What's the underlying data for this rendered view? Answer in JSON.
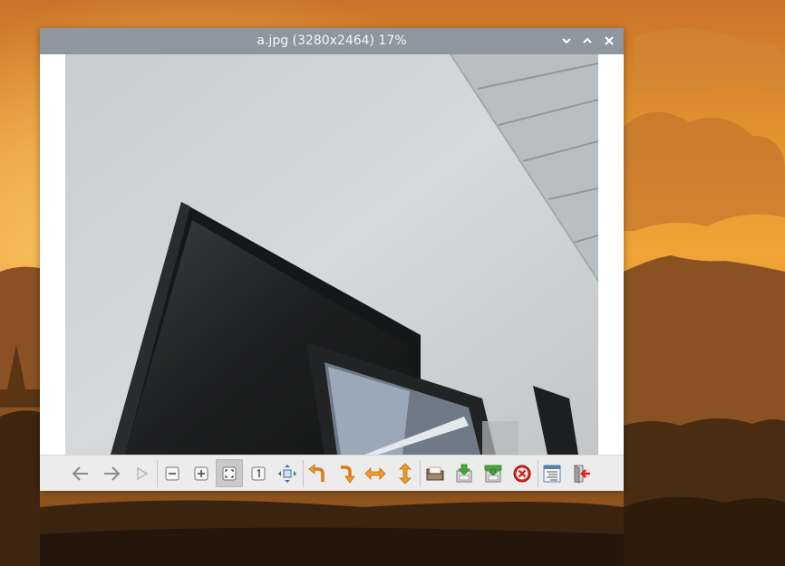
{
  "window": {
    "title": "a.jpg (3280x2464) 17%",
    "controls": [
      "minimize",
      "maximize",
      "close"
    ]
  },
  "image": {
    "description_icon": "photo-image",
    "subject_icons": [
      "monitor",
      "laptop-screen",
      "ceiling"
    ]
  },
  "toolbar": {
    "items": [
      {
        "name": "previous",
        "icon": "arrow-left-icon",
        "enabled": true
      },
      {
        "name": "next",
        "icon": "arrow-right-icon",
        "enabled": true
      },
      {
        "name": "slideshow",
        "icon": "play-icon",
        "enabled": false
      },
      {
        "name": "zoom-out",
        "icon": "zoom-out-icon",
        "enabled": true
      },
      {
        "name": "zoom-in",
        "icon": "zoom-in-icon",
        "enabled": true
      },
      {
        "name": "fit-to-window",
        "icon": "fit-window-icon",
        "enabled": true,
        "active": true
      },
      {
        "name": "original-size",
        "icon": "original-size-icon",
        "enabled": true
      },
      {
        "name": "fullscreen",
        "icon": "fullscreen-icon",
        "enabled": true
      },
      {
        "name": "rotate-left",
        "icon": "rotate-left-icon",
        "enabled": true
      },
      {
        "name": "rotate-right",
        "icon": "rotate-right-icon",
        "enabled": true
      },
      {
        "name": "flip-horizontal",
        "icon": "flip-horizontal-icon",
        "enabled": true
      },
      {
        "name": "flip-vertical",
        "icon": "flip-vertical-icon",
        "enabled": true
      },
      {
        "name": "open-file",
        "icon": "open-folder-icon",
        "enabled": true
      },
      {
        "name": "save-file",
        "icon": "save-icon",
        "enabled": true
      },
      {
        "name": "save-as",
        "icon": "save-as-icon",
        "enabled": true
      },
      {
        "name": "delete-file",
        "icon": "delete-icon",
        "enabled": true
      },
      {
        "name": "preferences",
        "icon": "preferences-icon",
        "enabled": true
      },
      {
        "name": "quit",
        "icon": "quit-icon",
        "enabled": true
      }
    ]
  },
  "colors": {
    "titlebar": "#8e979f",
    "toolbar_bg": "#ececec",
    "accent_orange": "#f0891a",
    "accent_green": "#3b9a34",
    "accent_red": "#d0211b",
    "arrow_gray": "#8b8b8b"
  }
}
